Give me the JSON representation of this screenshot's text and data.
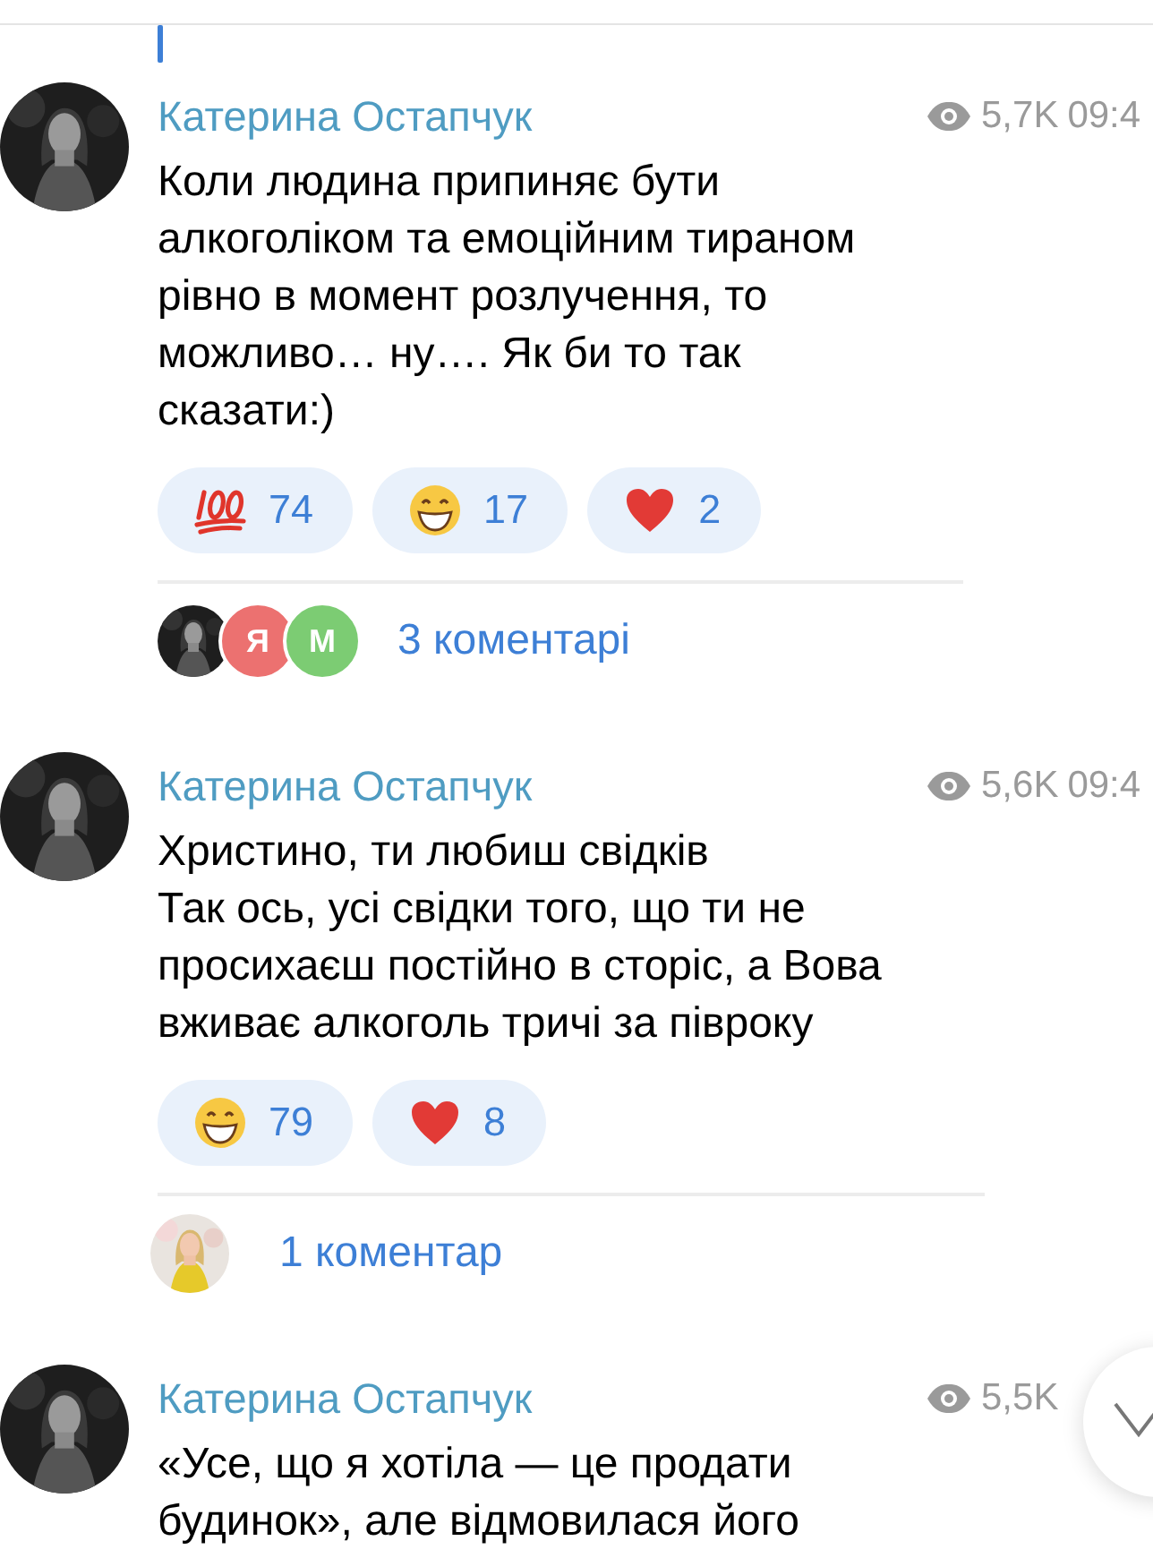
{
  "posts": [
    {
      "author": "Катерина Остапчук",
      "views": "5,7K",
      "time": "09:4",
      "lines": [
        "Коли людина припиняє бути",
        "алкоголіком та емоційним тираном",
        "рівно в момент розлучення, то",
        "можливо… ну…. Як би то так",
        "сказати:)"
      ],
      "reactions": [
        {
          "kind": "hundred",
          "count": "74"
        },
        {
          "kind": "grin",
          "count": "17"
        },
        {
          "kind": "heart",
          "count": "2"
        }
      ],
      "comments": {
        "avatars": [
          {
            "kind": "picture"
          },
          {
            "kind": "letter",
            "letter": "Я",
            "color": "#ec7170"
          },
          {
            "kind": "letter",
            "letter": "М",
            "color": "#7ccc73"
          }
        ],
        "label": "3 коментарі"
      }
    },
    {
      "author": "Катерина Остапчук",
      "views": "5,6K",
      "time": "09:4",
      "lines": [
        "Христино, ти любиш свідків",
        "Так ось, усі свідки того, що ти не",
        "просихаєш постійно в сторіс, а Вова",
        "вживає алкоголь тричі за півроку"
      ],
      "reactions": [
        {
          "kind": "grin",
          "count": "79"
        },
        {
          "kind": "heart",
          "count": "8"
        }
      ],
      "comments": {
        "avatars": [
          {
            "kind": "picture"
          }
        ],
        "label": "1 коментар"
      }
    },
    {
      "author": "Катерина Остапчук",
      "views": "5,5K",
      "lines": [
        "«Усе, що я хотіла — це продати",
        "будинок», але відмовилася його"
      ]
    }
  ]
}
